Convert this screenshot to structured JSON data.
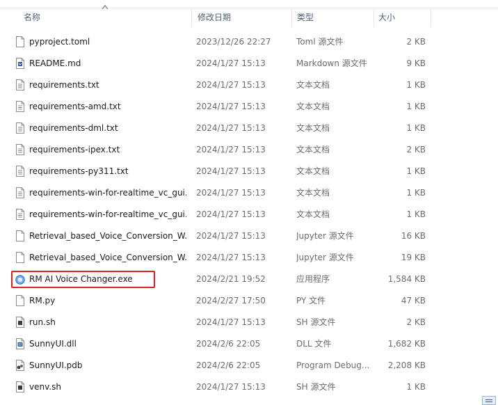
{
  "header": {
    "name": "名称",
    "date": "修改日期",
    "type": "类型",
    "size": "大小"
  },
  "files": [
    {
      "name": "pyproject.toml",
      "date": "2023/12/26 22:27",
      "type": "Toml 源文件",
      "size": "2 KB",
      "icon": "document-icon"
    },
    {
      "name": "README.md",
      "date": "2024/1/27 15:13",
      "type": "Markdown 源文件",
      "size": "9 KB",
      "icon": "markdown-file-icon"
    },
    {
      "name": "requirements.txt",
      "date": "2024/1/27 15:13",
      "type": "文本文档",
      "size": "1 KB",
      "icon": "text-file-icon"
    },
    {
      "name": "requirements-amd.txt",
      "date": "2024/1/27 15:13",
      "type": "文本文档",
      "size": "1 KB",
      "icon": "text-file-icon"
    },
    {
      "name": "requirements-dml.txt",
      "date": "2024/1/27 15:13",
      "type": "文本文档",
      "size": "1 KB",
      "icon": "text-file-icon"
    },
    {
      "name": "requirements-ipex.txt",
      "date": "2024/1/27 15:13",
      "type": "文本文档",
      "size": "2 KB",
      "icon": "text-file-icon"
    },
    {
      "name": "requirements-py311.txt",
      "date": "2024/1/27 15:13",
      "type": "文本文档",
      "size": "1 KB",
      "icon": "text-file-icon"
    },
    {
      "name": "requirements-win-for-realtime_vc_gui...",
      "date": "2024/1/27 15:13",
      "type": "文本文档",
      "size": "1 KB",
      "icon": "text-file-icon"
    },
    {
      "name": "requirements-win-for-realtime_vc_gui...",
      "date": "2024/1/27 15:13",
      "type": "文本文档",
      "size": "1 KB",
      "icon": "text-file-icon"
    },
    {
      "name": "Retrieval_based_Voice_Conversion_W...",
      "date": "2024/1/27 15:13",
      "type": "Jupyter 源文件",
      "size": "16 KB",
      "icon": "document-icon"
    },
    {
      "name": "Retrieval_based_Voice_Conversion_W...",
      "date": "2024/1/27 15:13",
      "type": "Jupyter 源文件",
      "size": "19 KB",
      "icon": "document-icon"
    },
    {
      "name": "RM AI Voice Changer.exe",
      "date": "2024/2/21 19:52",
      "type": "应用程序",
      "size": "1,584 KB",
      "icon": "app-exe-icon"
    },
    {
      "name": "RM.py",
      "date": "2024/2/27 17:50",
      "type": "PY 文件",
      "size": "47 KB",
      "icon": "blank-file-icon"
    },
    {
      "name": "run.sh",
      "date": "2024/1/27 15:13",
      "type": "SH 源文件",
      "size": "2 KB",
      "icon": "script-file-icon"
    },
    {
      "name": "SunnyUI.dll",
      "date": "2024/2/6 22:05",
      "type": "DLL 文件",
      "size": "1,682 KB",
      "icon": "dll-file-icon"
    },
    {
      "name": "SunnyUI.pdb",
      "date": "2024/2/6 22:05",
      "type": "Program Debug...",
      "size": "2,208 KB",
      "icon": "pdb-file-icon"
    },
    {
      "name": "venv.sh",
      "date": "2024/1/27 15:13",
      "type": "SH 源文件",
      "size": "1 KB",
      "icon": "script-file-icon"
    }
  ],
  "highlighted_file": "RM AI Voice Changer.exe",
  "colors": {
    "highlight": "#e02020",
    "header_text": "#4c607a",
    "secondary_text": "#6d6d6d"
  }
}
